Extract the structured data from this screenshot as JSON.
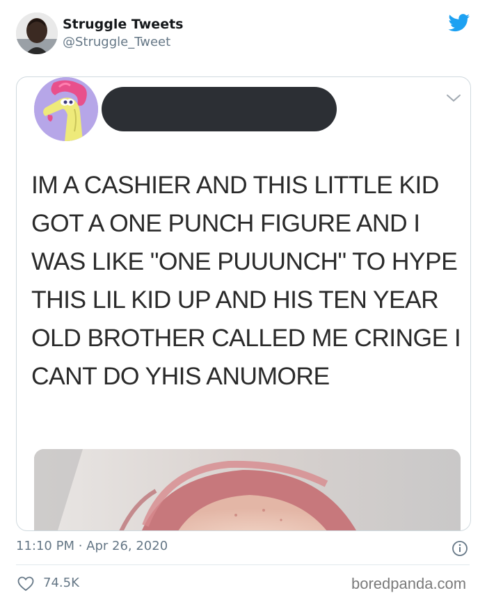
{
  "tweet": {
    "author_name": "Struggle Tweets",
    "author_handle": "@Struggle_Tweet",
    "timestamp": "11:10 PM · Apr 26, 2020",
    "like_count": "74.5K"
  },
  "embedded": {
    "text": "IM A CASHIER AND THIS LITTLE KID GOT A ONE PUNCH FIGURE AND I WAS LIKE \"ONE PUUUNCH\" TO HYPE THIS LIL KID UP AND HIS TEN YEAR OLD BROTHER CALLED ME CRINGE I CANT DO YHIS ANUMORE"
  },
  "watermark": "boredpanda.com",
  "icons": {
    "brand": "twitter-bird-icon",
    "menu": "chevron-down-icon",
    "info": "info-icon",
    "like": "heart-icon"
  },
  "colors": {
    "twitter_blue": "#1da1f2",
    "muted_text": "#657786",
    "redaction": "#2c2f34"
  }
}
